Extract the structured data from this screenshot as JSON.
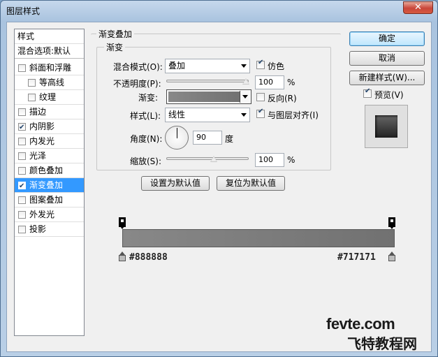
{
  "window": {
    "title": "图层样式",
    "close": "✕"
  },
  "style_list": {
    "header": "样式",
    "blend_options": "混合选项:默认",
    "items": [
      {
        "label": "斜面和浮雕",
        "checked": false
      },
      {
        "label": "等高线",
        "checked": false
      },
      {
        "label": "纹理",
        "checked": false
      },
      {
        "label": "描边",
        "checked": false
      },
      {
        "label": "内阴影",
        "checked": true
      },
      {
        "label": "内发光",
        "checked": false
      },
      {
        "label": "光泽",
        "checked": false
      },
      {
        "label": "颜色叠加",
        "checked": false
      },
      {
        "label": "渐变叠加",
        "checked": true
      },
      {
        "label": "图案叠加",
        "checked": false
      },
      {
        "label": "外发光",
        "checked": false
      },
      {
        "label": "投影",
        "checked": false
      }
    ]
  },
  "buttons": {
    "ok": "确定",
    "cancel": "取消",
    "new_style": "新建样式(W)...",
    "preview": "预览(V)"
  },
  "gradient_overlay": {
    "section_title": "渐变叠加",
    "subsection_title": "渐变",
    "blend_mode_label": "混合模式(O):",
    "blend_mode_value": "叠加",
    "dither_label": "仿色",
    "opacity_label": "不透明度(P):",
    "opacity_value": "100",
    "opacity_unit": "%",
    "gradient_label": "渐变:",
    "reverse_label": "反向(R)",
    "style_label": "样式(L):",
    "style_value": "线性",
    "align_label": "与图层对齐(I)",
    "angle_label": "角度(N):",
    "angle_value": "90",
    "angle_unit": "度",
    "scale_label": "缩放(S):",
    "scale_value": "100",
    "scale_unit": "%",
    "set_default": "设置为默认值",
    "reset_default": "复位为默认值"
  },
  "gradient_editor": {
    "start_color": "#888888",
    "end_color": "#717171",
    "start_label": "#888888",
    "end_label": "#717171"
  },
  "watermark": {
    "line1": "fevte.com",
    "line2": "飞特教程网"
  }
}
